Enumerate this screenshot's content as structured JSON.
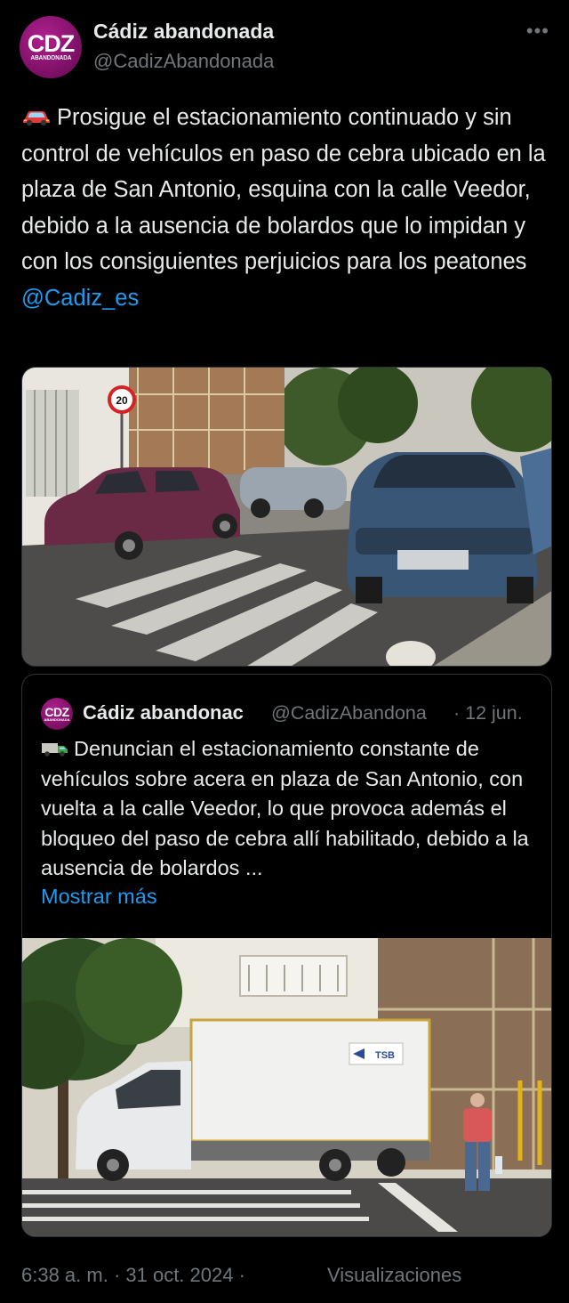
{
  "author": {
    "avatar_text": "CDZ",
    "avatar_subtext": "ABANDONADA",
    "name": "Cádiz abandonada",
    "handle": "@CadizAbandonada"
  },
  "more_icon": "more-horizontal-icon",
  "tweet": {
    "emoji": "red-car-icon",
    "text": "Prosigue el estacionamiento continuado y sin control de vehículos en paso de cebra ubicado en la plaza de San Antonio, esquina con la calle Veedor, debido a la ausencia de bolardos que lo impidan y con los consiguientes perjuicios para los peatones",
    "mention": "@Cadiz_es",
    "mention_color": "#1d9bf0"
  },
  "photo": {
    "sign_text": "20"
  },
  "quote": {
    "name": "Cádiz abandonac",
    "handle": "@CadizAbandona",
    "date": "· 12 jun.",
    "emoji": "delivery-truck-icon",
    "text": "Denuncian el estacionamiento constante de vehículos sobre acera en plaza de San Antonio, con vuelta a la calle Veedor, lo que provoca además el bloqueo del paso de cebra allí habilitado, debido a la ausencia de bolardos ...",
    "show_more": "Mostrar más",
    "photo_truck_logo": "TSB"
  },
  "footer": {
    "time": "6:38 a. m. · 31 oct. 2024 ·",
    "views": "Visualizaciones"
  },
  "colors": {
    "background": "#000000",
    "text": "#e7e9ea",
    "secondary": "#71767b",
    "link": "#1d9bf0",
    "avatar": "#8e1674"
  }
}
